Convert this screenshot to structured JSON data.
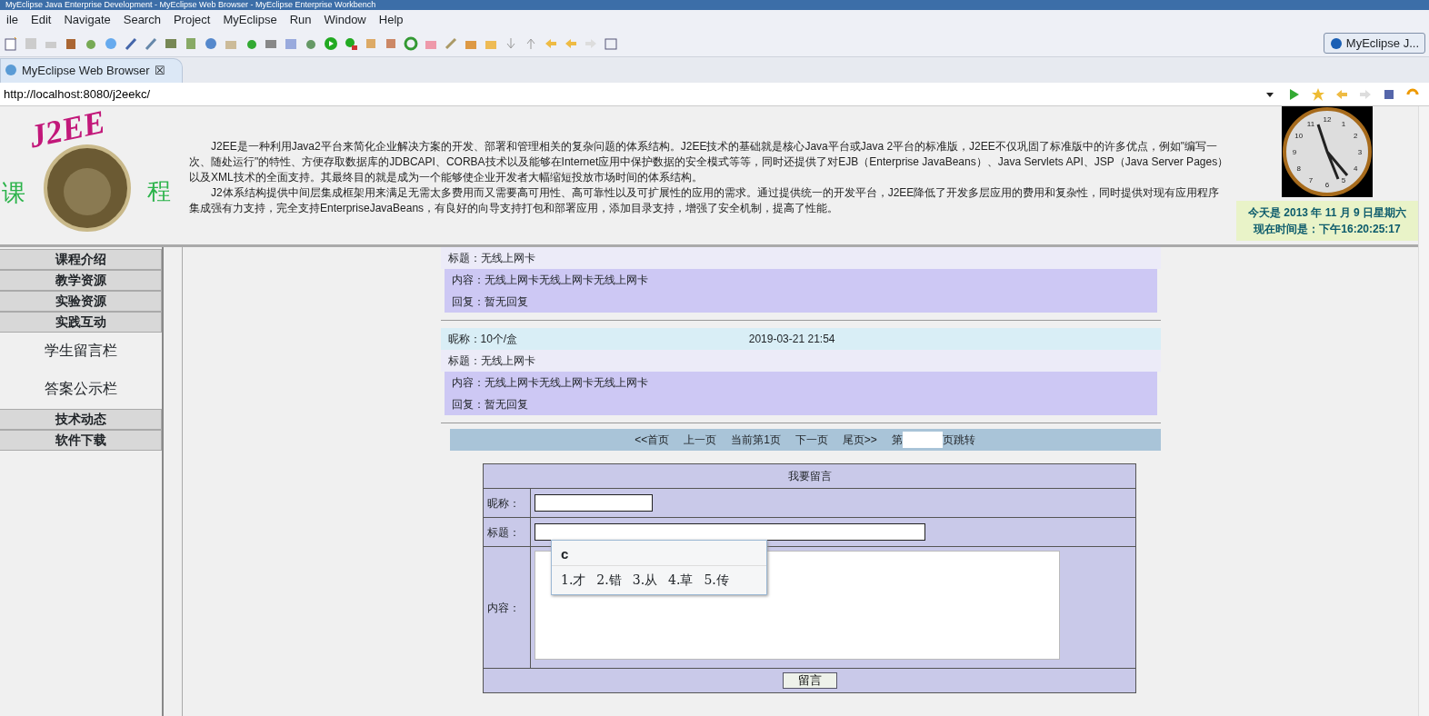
{
  "window": {
    "title": "MyEclipse Java Enterprise Development - MyEclipse Web Browser - MyEclipse Enterprise Workbench"
  },
  "menu": [
    "ile",
    "Edit",
    "Navigate",
    "Search",
    "Project",
    "MyEclipse",
    "Run",
    "Window",
    "Help"
  ],
  "perspective": {
    "label": "MyEclipse J..."
  },
  "editor_tab": {
    "label": "MyEclipse Web Browser",
    "close": "☒"
  },
  "address": {
    "value": "http://localhost:8080/j2eekc/"
  },
  "header": {
    "logo": {
      "title": "J2EE",
      "left": "课",
      "right": "程"
    },
    "paragraphs": [
      "J2EE是一种利用Java2平台来简化企业解决方案的开发、部署和管理相关的复杂问题的体系结构。J2EE技术的基础就是核心Java平台或Java 2平台的标准版，J2EE不仅巩固了标准版中的许多优点，例如\"编写一次、随处运行\"的特性、方便存取数据库的JDBCAPI、CORBA技术以及能够在Internet应用中保护数据的安全模式等等，同时还提供了对EJB（Enterprise JavaBeans）、Java Servlets API、JSP（Java Server Pages）以及XML技术的全面支持。其最终目的就是成为一个能够使企业开发者大幅缩短投放市场时间的体系结构。",
      "J2体系结构提供中间层集成框架用来满足无需太多费用而又需要高可用性、高可靠性以及可扩展性的应用的需求。通过提供统一的开发平台，J2EE降低了开发多层应用的费用和复杂性，同时提供对现有应用程序集成强有力支持，完全支持EnterpriseJavaBeans，有良好的向导支持打包和部署应用，添加目录支持，增强了安全机制，提高了性能。"
    ],
    "clock": {
      "numbers": [
        "12",
        "1",
        "2",
        "3",
        "4",
        "5",
        "6",
        "7",
        "8",
        "9",
        "10",
        "11"
      ]
    },
    "date_line": "今天是 2013 年 11 月 9 日星期六",
    "time_line": "现在时间是：下午16:20:25:17"
  },
  "nav": [
    {
      "kind": "section",
      "label": "课程介绍"
    },
    {
      "kind": "section",
      "label": "教学资源"
    },
    {
      "kind": "section",
      "label": "实验资源"
    },
    {
      "kind": "section",
      "label": "实践互动"
    },
    {
      "kind": "sub",
      "label": "学生留言栏"
    },
    {
      "kind": "sub",
      "label": "答案公示栏"
    },
    {
      "kind": "section",
      "label": "技术动态"
    },
    {
      "kind": "section",
      "label": "软件下载"
    }
  ],
  "messages": [
    {
      "title": "标题：无线上网卡",
      "content": "内容：无线上网卡无线上网卡无线上网卡",
      "reply": "回复：暂无回复"
    },
    {
      "nickname": "昵称：10个/盒",
      "date": "2019-03-21 21:54",
      "title": "标题：无线上网卡",
      "content": "内容：无线上网卡无线上网卡无线上网卡",
      "reply": "回复：暂无回复"
    }
  ],
  "pager": {
    "links": [
      "<<首页",
      "上一页",
      "当前第1页",
      "下一页",
      "尾页>>"
    ],
    "before": "第",
    "after": "页跳转"
  },
  "form": {
    "heading": "我要留言",
    "nickname_label": "昵称：",
    "title_label": "标题：",
    "content_label": "内容：",
    "submit": "留言"
  },
  "ime": {
    "composition": "c",
    "candidates": [
      "1.才",
      "2.错",
      "3.从",
      "4.草",
      "5.传"
    ]
  }
}
